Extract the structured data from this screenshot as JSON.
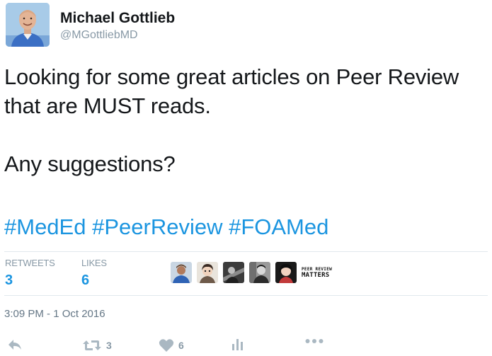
{
  "author": {
    "display_name": "Michael Gottlieb",
    "handle": "@MGottliebMD",
    "avatar_icon": "profile-photo"
  },
  "tweet": {
    "lines": [
      "Looking for some great articles on Peer Review",
      "that are MUST reads.",
      "Any suggestions?"
    ],
    "hashtags": [
      "#MedEd",
      "#PeerReview",
      "#FOAMed"
    ]
  },
  "stats": {
    "retweets_label": "RETWEETS",
    "retweets_count": "3",
    "likes_label": "LIKES",
    "likes_count": "6"
  },
  "likers": [
    {
      "icon": "liker-avatar-1"
    },
    {
      "icon": "liker-avatar-2"
    },
    {
      "icon": "liker-avatar-3"
    },
    {
      "icon": "liker-avatar-4"
    },
    {
      "icon": "liker-avatar-5"
    },
    {
      "icon": "peer-review-matters-logo",
      "logo_text_top": "PEER REVIEW",
      "logo_text_bottom": "MATTERS"
    }
  ],
  "timestamp": "3:09 PM - 1 Oct 2016",
  "actions": {
    "reply_icon": "reply-icon",
    "retweet_icon": "retweet-icon",
    "retweet_count": "3",
    "like_icon": "heart-icon",
    "like_count": "6",
    "analytics_icon": "analytics-icon",
    "more_icon": "more-icon"
  },
  "colors": {
    "link": "#1b95e0",
    "muted": "#8899a6",
    "icon": "#aab8c2"
  }
}
